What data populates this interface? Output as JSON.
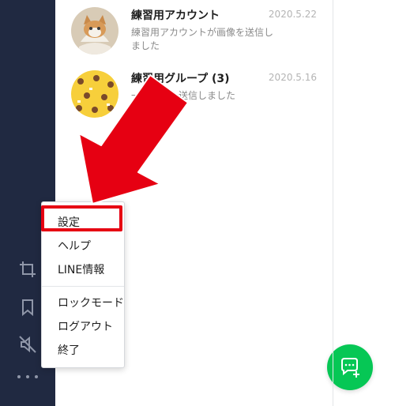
{
  "sidebar": {
    "icons": [
      "crop-icon",
      "bookmark-icon",
      "mute-icon",
      "more-icon"
    ]
  },
  "chats": [
    {
      "name": "練習用アカウント",
      "preview": "練習用アカウントが画像を送信しました",
      "date": "2020.5.22",
      "avatar": "kitten-photo"
    },
    {
      "name": "練習用グループ (3)",
      "preview": "一　　　　送信しました",
      "date": "2020.5.16",
      "avatar": "yellow-bear-pattern"
    }
  ],
  "menu": {
    "items": [
      "設定",
      "ヘルプ",
      "LINE情報",
      "ロックモード",
      "ログアウト",
      "終了"
    ]
  },
  "fab": {
    "icon": "new-chat-icon"
  },
  "colors": {
    "sidebar": "#202941",
    "accent_green": "#06c755",
    "annotation_red": "#e60012"
  }
}
